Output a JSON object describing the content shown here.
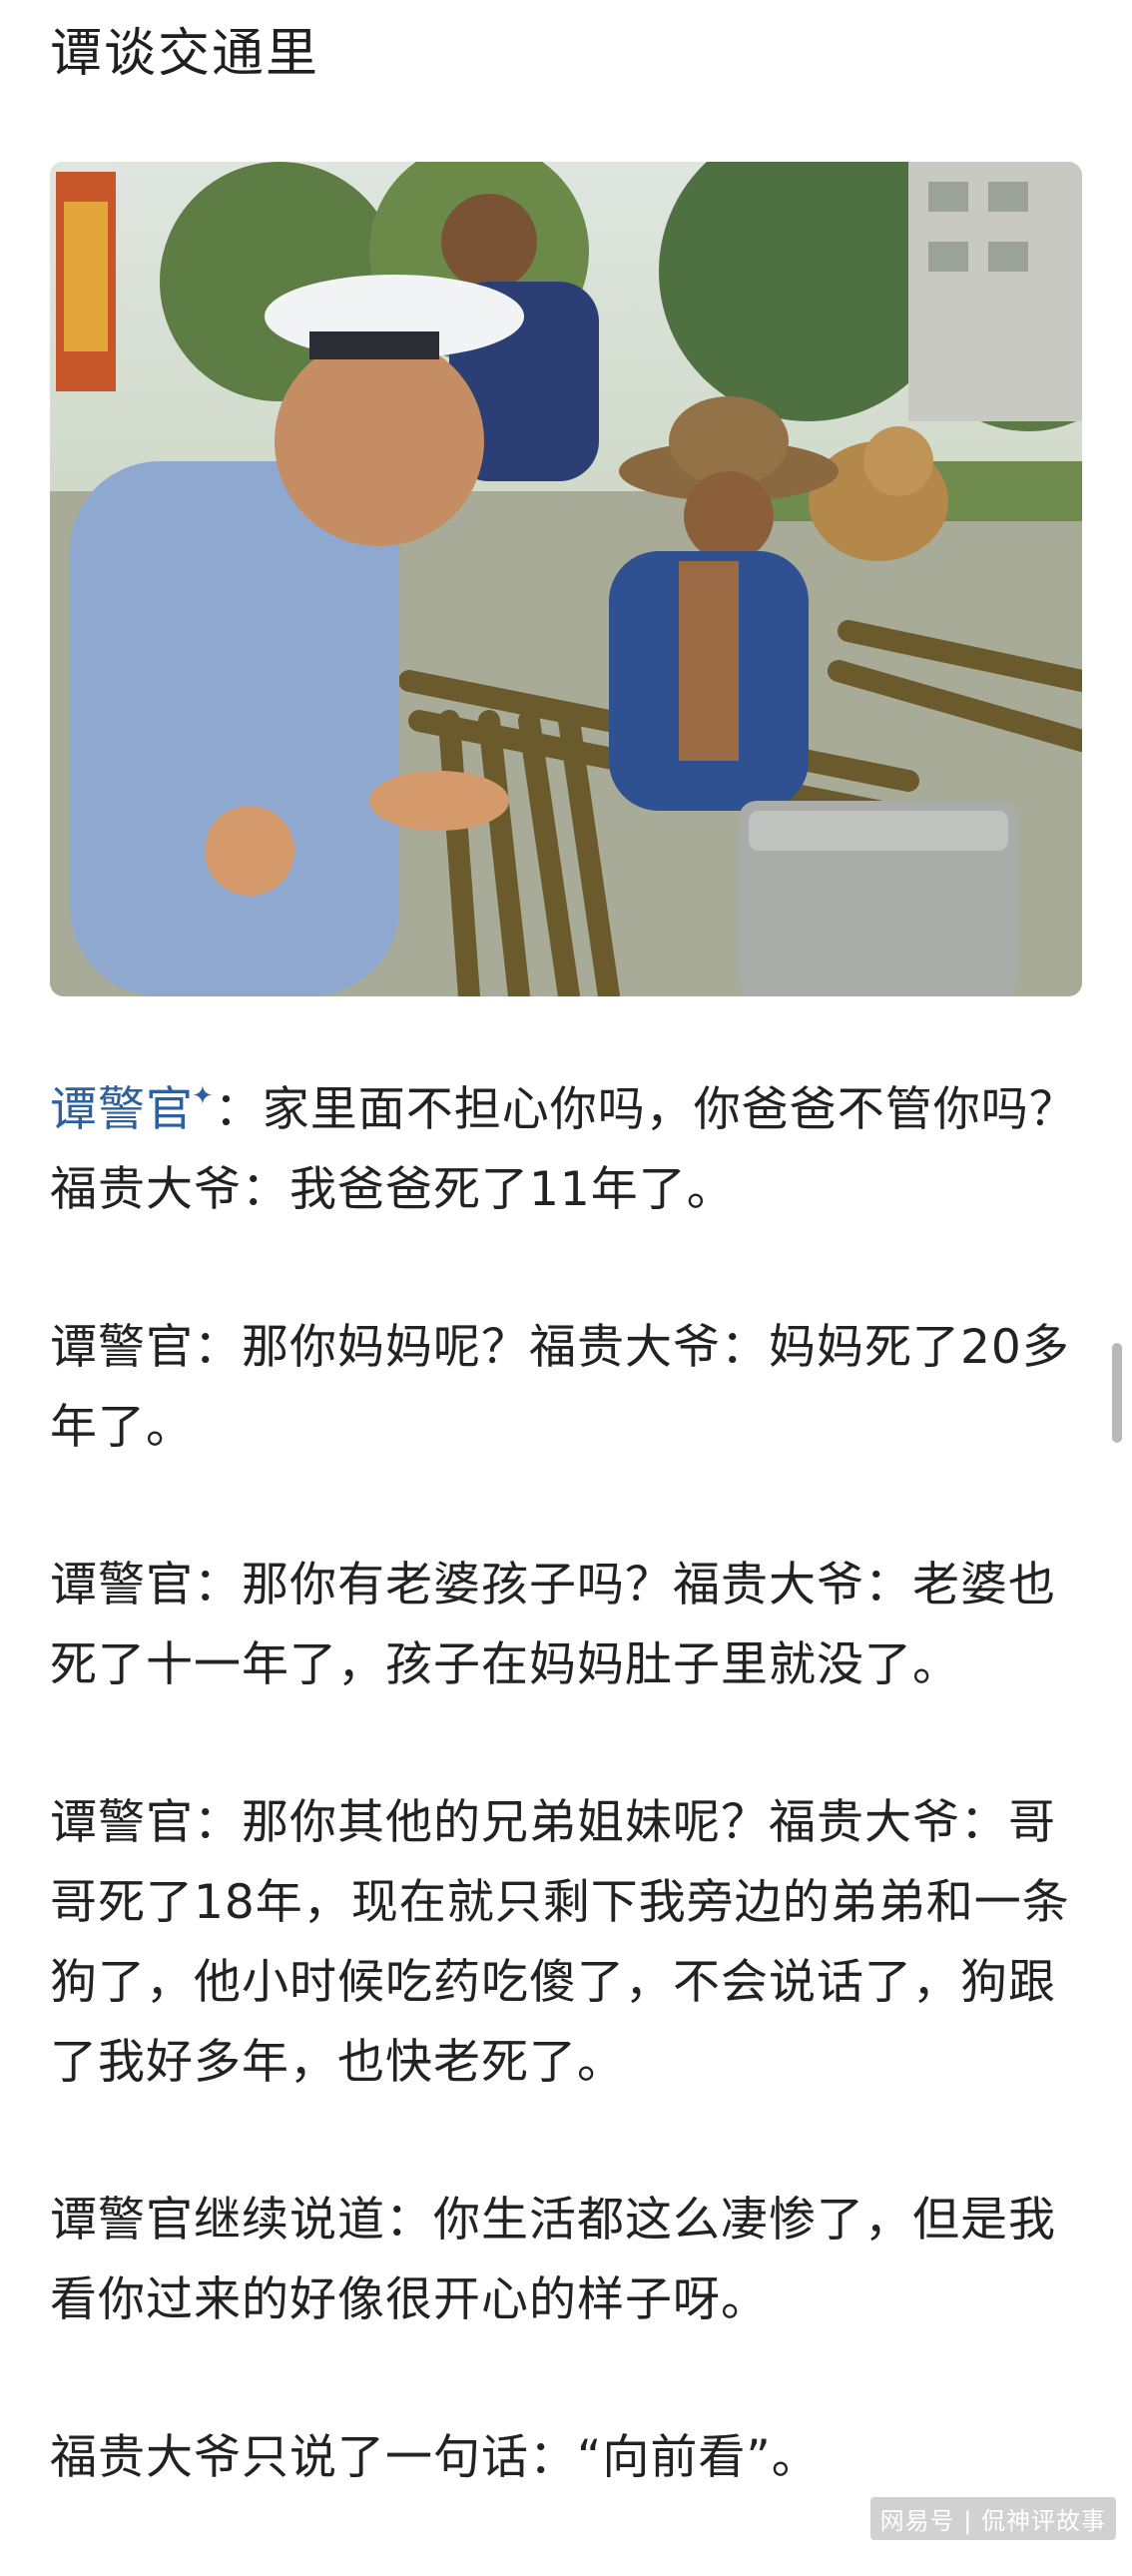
{
  "title": "谭谈交通里",
  "paragraphs": [
    {
      "mention": "谭警官",
      "text": "：家里面不担心你吗，你爸爸不管你吗？福贵大爷：我爸爸死了11年了。"
    },
    {
      "text": "谭警官：那你妈妈呢？福贵大爷：妈妈死了20多年了。"
    },
    {
      "text": "谭警官：那你有老婆孩子吗？福贵大爷：老婆也死了十一年了，孩子在妈妈肚子里就没了。"
    },
    {
      "text": "谭警官：那你其他的兄弟姐妹呢？福贵大爷：哥哥死了18年，现在就只剩下我旁边的弟弟和一条狗了，他小时候吃药吃傻了，不会说话了，狗跟了我好多年，也快老死了。"
    },
    {
      "text": "谭警官继续说道：你生活都这么凄惨了，但是我看你过来的好像很开心的样子呀。"
    },
    {
      "text": "福贵大爷只说了一句话：“向前看”。"
    }
  ],
  "mention_icon": "sparkle-icon",
  "watermark": "网易号 | 侃神评故事",
  "colors": {
    "mention": "#2e5f9e",
    "text": "#222222",
    "background": "#ffffff"
  }
}
